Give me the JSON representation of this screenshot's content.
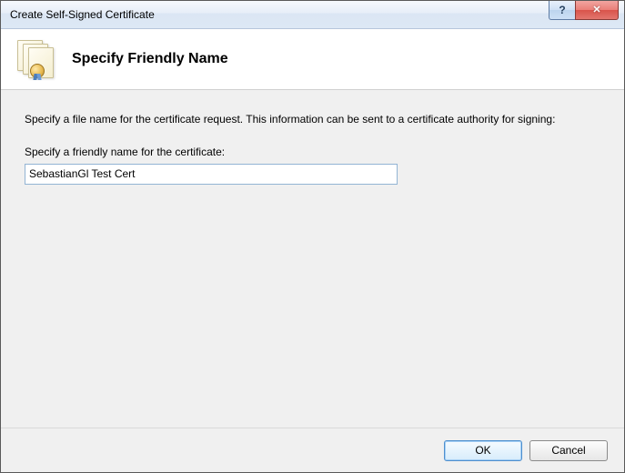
{
  "window": {
    "title": "Create Self-Signed Certificate"
  },
  "header": {
    "title": "Specify Friendly Name"
  },
  "body": {
    "instruction": "Specify a file name for the certificate request.  This information can be sent to a certificate authority for signing:",
    "field_label": "Specify a friendly name for the certificate:",
    "field_value": "SebastianGl Test Cert"
  },
  "footer": {
    "ok_label": "OK",
    "cancel_label": "Cancel"
  },
  "icons": {
    "help": "?",
    "close": "✕"
  }
}
